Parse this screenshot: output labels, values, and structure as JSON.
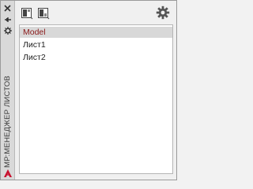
{
  "panel_title": "МР:МЕНЕДЖЕР ЛИСТОВ",
  "strip_icons": [
    "close-icon",
    "pin-icon",
    "properties-icon"
  ],
  "toolbar_icons": [
    "layout-view-icon",
    "model-view-icon",
    "settings-icon"
  ],
  "layouts": [
    {
      "label": "Model",
      "selected": true
    },
    {
      "label": "Лист1",
      "selected": false
    },
    {
      "label": "Лист2",
      "selected": false
    }
  ],
  "colors": {
    "accent_selected_text": "#8b1a1a",
    "logo": "#c8102e"
  }
}
